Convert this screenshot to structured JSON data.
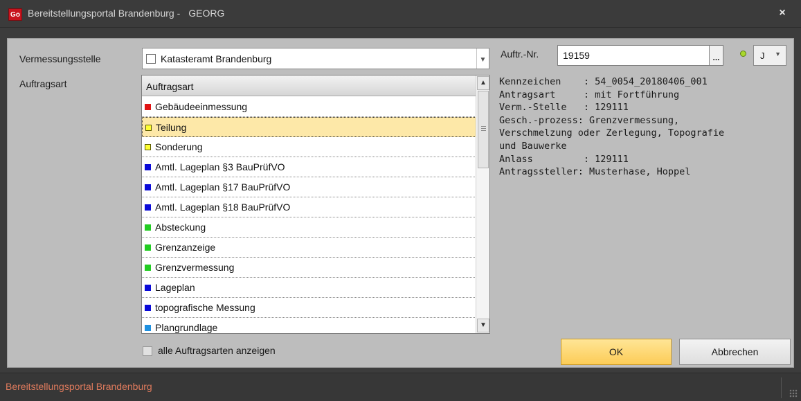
{
  "window": {
    "logo_text": "Go",
    "title": "Bereitstellungsportal Brandenburg -",
    "subtitle": "GEORG",
    "close_glyph": "×"
  },
  "form": {
    "vermessungsstelle_label": "Vermessungsstelle",
    "vermessungsstelle_value": "Katasteramt Brandenburg",
    "auftragsart_label": "Auftragsart",
    "list_header": "Auftragsart",
    "list_items": [
      {
        "label": "Gebäudeeinmessung",
        "color": "#e01414",
        "hollow": false,
        "selected": false
      },
      {
        "label": "Teilung",
        "color": "#ffff33",
        "hollow": true,
        "selected": true
      },
      {
        "label": "Sonderung",
        "color": "#ffff33",
        "hollow": true,
        "selected": false
      },
      {
        "label": "Amtl. Lageplan §3 BauPrüfVO",
        "color": "#0a0ad8",
        "hollow": false,
        "selected": false
      },
      {
        "label": "Amtl. Lageplan §17 BauPrüfVO",
        "color": "#0a0ad8",
        "hollow": false,
        "selected": false
      },
      {
        "label": "Amtl. Lageplan §18 BauPrüfVO",
        "color": "#0a0ad8",
        "hollow": false,
        "selected": false
      },
      {
        "label": "Absteckung",
        "color": "#22cc22",
        "hollow": false,
        "selected": false
      },
      {
        "label": "Grenzanzeige",
        "color": "#22cc22",
        "hollow": false,
        "selected": false
      },
      {
        "label": "Grenzvermessung",
        "color": "#22cc22",
        "hollow": false,
        "selected": false
      },
      {
        "label": "Lageplan",
        "color": "#0a0ad8",
        "hollow": false,
        "selected": false
      },
      {
        "label": "topografische Messung",
        "color": "#0a0ad8",
        "hollow": false,
        "selected": false
      },
      {
        "label": "Plangrundlage",
        "color": "#1e90e0",
        "hollow": false,
        "selected": false
      }
    ],
    "show_all_label": "alle Auftragsarten anzeigen",
    "auftr_nr_label": "Auftr.-Nr.",
    "auftr_nr_value": "19159",
    "browse_glyph": "...",
    "j_value": "J",
    "status_led_color": "#a9d82c"
  },
  "info_lines": [
    "Kennzeichen    : 54_0054_20180406_001",
    "Antragsart     : mit Fortführung",
    "Verm.-Stelle   : 129111",
    "Gesch.-prozess: Grenzvermessung,",
    "Verschmelzung oder Zerlegung, Topografie",
    "und Bauwerke",
    "Anlass         : 129111",
    "Antragssteller: Musterhase, Hoppel"
  ],
  "buttons": {
    "ok": "OK",
    "cancel": "Abbrechen"
  },
  "statusbar": {
    "text": "Bereitstellungsportal Brandenburg"
  },
  "icons": {
    "scroll_up": "scroll-up-icon",
    "scroll_down": "scroll-down-icon",
    "dropdown": "chevron-down-icon"
  }
}
